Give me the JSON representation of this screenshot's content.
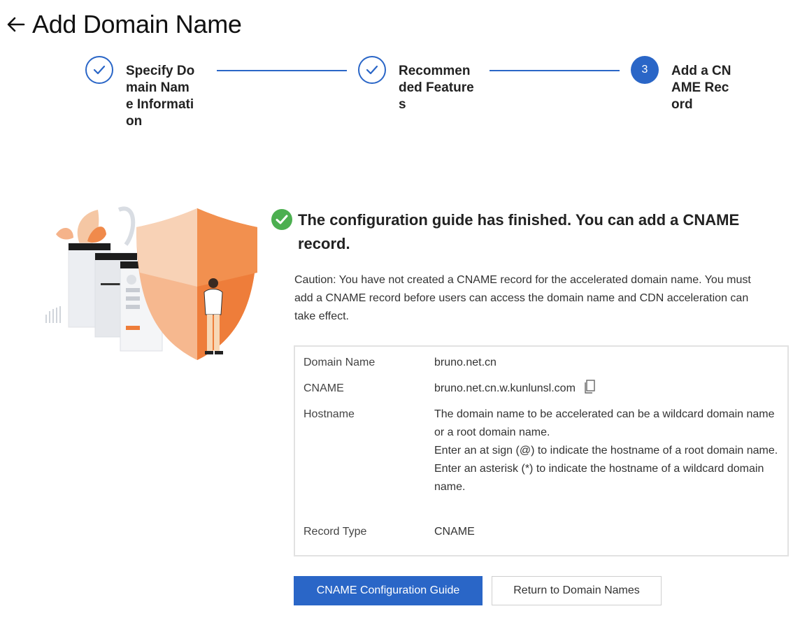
{
  "header": {
    "title": "Add Domain Name"
  },
  "steps": [
    {
      "label": "Specify Domain Name Information",
      "state": "done"
    },
    {
      "label": "Recommended Features",
      "state": "done"
    },
    {
      "label": "Add a CNAME Record",
      "number": "3",
      "state": "active"
    }
  ],
  "result": {
    "title": "The configuration guide has finished. You can add a CNAME record.",
    "caution": "Caution: You have not created a CNAME record for the accelerated domain name. You must add a CNAME record before users can access the domain name and CDN acceleration can take effect."
  },
  "info": {
    "domain_label": "Domain Name",
    "domain_value": "bruno.net.cn",
    "cname_label": "CNAME",
    "cname_value": "bruno.net.cn.w.kunlunsl.com",
    "hostname_label": "Hostname",
    "hostname_lines": [
      "The domain name to be accelerated can be a wildcard domain name or a root domain name.",
      "Enter an at sign (@) to indicate the hostname of a root domain name.",
      "Enter an asterisk (*) to indicate the hostname of a wildcard domain name."
    ],
    "record_type_label": "Record Type",
    "record_type_value": "CNAME"
  },
  "buttons": {
    "primary": "CNAME Configuration Guide",
    "secondary": "Return to Domain Names"
  },
  "colors": {
    "accent": "#2a66c7",
    "success": "#4caf50",
    "illustration_orange": "#ee7d3a"
  }
}
